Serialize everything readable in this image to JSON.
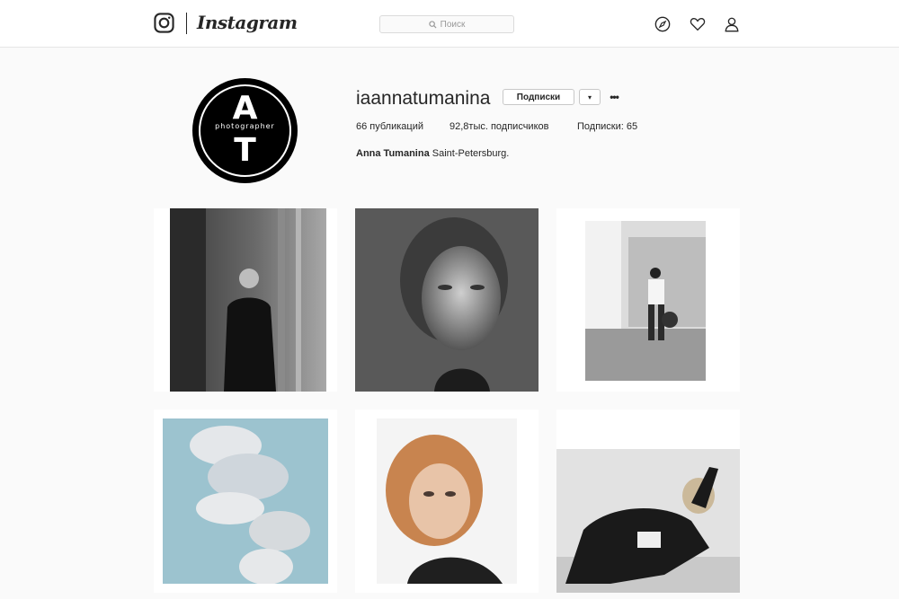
{
  "header": {
    "brand": "Instagram",
    "search_placeholder": "Поиск",
    "icons": [
      "instagram-logo-icon",
      "search-icon",
      "explore-compass-icon",
      "heart-icon",
      "profile-icon"
    ]
  },
  "profile": {
    "avatar_text_top": "A",
    "avatar_text_mid": "photographer",
    "avatar_text_bottom": "T",
    "username": "iaannatumanina",
    "follow_label": "Подписки",
    "dropdown_label": "▾",
    "more_label": "•••",
    "posts": "66 публикаций",
    "followers": "92,8тыс. подписчиков",
    "following": "Подписки: 65",
    "bio_name": "Anna Tumanina",
    "bio_text": " Saint-Petersburg."
  },
  "posts": [
    {
      "subject": "woman in black coat on street"
    },
    {
      "subject": "close-up portrait"
    },
    {
      "subject": "man with basketball"
    },
    {
      "subject": "cloud against blue sky"
    },
    {
      "subject": "portrait with reddish hair"
    },
    {
      "subject": "woman lying down"
    }
  ],
  "colors": {
    "background": "#fafafa",
    "header_bg": "#ffffff",
    "border": "#dbdbdb",
    "text": "#262626",
    "avatar_bg": "#000000"
  }
}
